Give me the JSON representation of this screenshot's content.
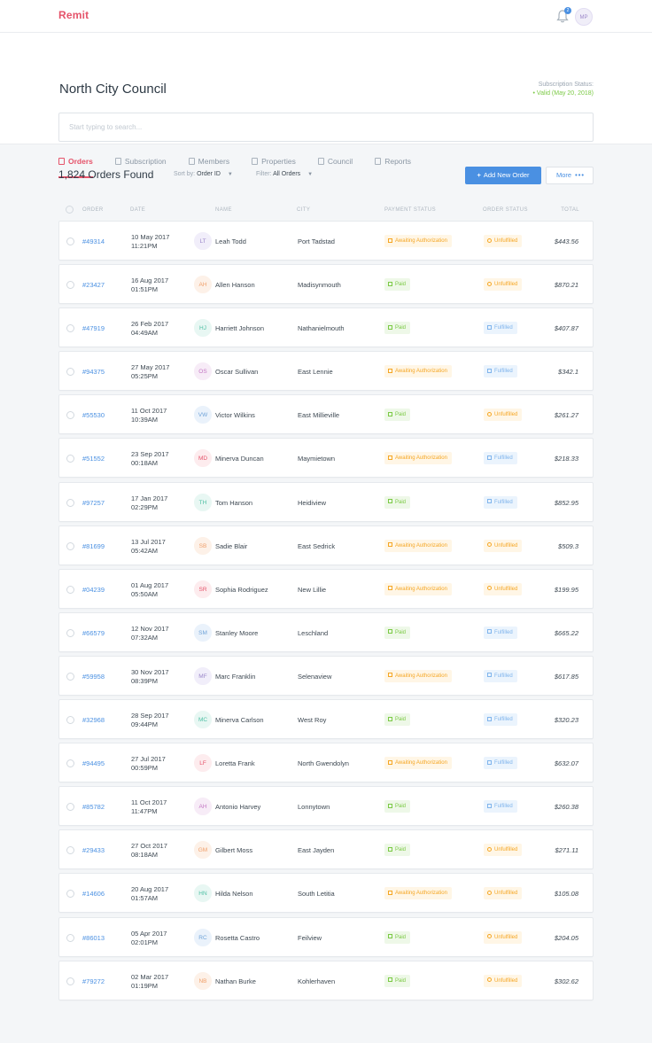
{
  "app": {
    "logo": "Remit",
    "avatar_initials": "MP",
    "notification_count": "2"
  },
  "header": {
    "title": "North City Council",
    "subscription_label": "Subscription Status:",
    "subscription_value": "• Valid (May 20, 2018)"
  },
  "search": {
    "placeholder": "Start typing to search..."
  },
  "tabs": [
    {
      "label": "Orders",
      "icon": "orders-icon"
    },
    {
      "label": "Subscription",
      "icon": "subscription-icon"
    },
    {
      "label": "Members",
      "icon": "members-icon"
    },
    {
      "label": "Properties",
      "icon": "properties-icon"
    },
    {
      "label": "Council",
      "icon": "council-icon"
    },
    {
      "label": "Reports",
      "icon": "reports-icon"
    }
  ],
  "toolbar": {
    "count": "1,824 Orders Found",
    "sort_label": "Sort by:",
    "sort_value": "Order ID",
    "filter_label": "Filter:",
    "filter_value": "All Orders",
    "add_button": "Add New Order",
    "more_button": "More"
  },
  "columns": [
    "ORDER",
    "DATE",
    "NAME",
    "CITY",
    "PAYMENT STATUS",
    "ORDER STATUS",
    "TOTAL"
  ],
  "orders": [
    {
      "id": "#49314",
      "date": "10 May 2017",
      "time": "11:21PM",
      "initials": "LT",
      "name": "Leah Todd",
      "city": "Port Tadstad",
      "payment": "Awaiting Authorization",
      "status": "Unfulfilled",
      "total": "$443.56",
      "av_bg": "#f1eefa",
      "av_fg": "#9b87c9"
    },
    {
      "id": "#23427",
      "date": "16 Aug 2017",
      "time": "01:51PM",
      "initials": "AH",
      "name": "Allen Hanson",
      "city": "Madisynmouth",
      "payment": "Paid",
      "status": "Unfulfilled",
      "total": "$870.21",
      "av_bg": "#fdf1e8",
      "av_fg": "#f0a06b"
    },
    {
      "id": "#47919",
      "date": "26 Feb 2017",
      "time": "04:49AM",
      "initials": "HJ",
      "name": "Harriett Johnson",
      "city": "Nathanielmouth",
      "payment": "Paid",
      "status": "Fulfilled",
      "total": "$407.87",
      "av_bg": "#e8f7f3",
      "av_fg": "#4dbfa3"
    },
    {
      "id": "#94375",
      "date": "27 May 2017",
      "time": "05:25PM",
      "initials": "OS",
      "name": "Oscar Sullivan",
      "city": "East Lennie",
      "payment": "Awaiting Authorization",
      "status": "Fulfilled",
      "total": "$342.1",
      "av_bg": "#f7ecf7",
      "av_fg": "#c477c4"
    },
    {
      "id": "#55530",
      "date": "11 Oct 2017",
      "time": "10:39AM",
      "initials": "VW",
      "name": "Victor Wilkins",
      "city": "East Millieville",
      "payment": "Paid",
      "status": "Unfulfilled",
      "total": "$261.27",
      "av_bg": "#eaf2fb",
      "av_fg": "#6fa3d8"
    },
    {
      "id": "#51552",
      "date": "23 Sep 2017",
      "time": "00:18AM",
      "initials": "MD",
      "name": "Minerva Duncan",
      "city": "Maymietown",
      "payment": "Awaiting Authorization",
      "status": "Fulfilled",
      "total": "$218.33",
      "av_bg": "#fdecee",
      "av_fg": "#e5536a"
    },
    {
      "id": "#97257",
      "date": "17 Jan 2017",
      "time": "02:29PM",
      "initials": "TH",
      "name": "Tom Hanson",
      "city": "Heidiview",
      "payment": "Paid",
      "status": "Fulfilled",
      "total": "$852.95",
      "av_bg": "#e8f7f3",
      "av_fg": "#4dbfa3"
    },
    {
      "id": "#81699",
      "date": "13 Jul 2017",
      "time": "05:42AM",
      "initials": "SB",
      "name": "Sadie Blair",
      "city": "East Sedrick",
      "payment": "Awaiting Authorization",
      "status": "Unfulfilled",
      "total": "$509.3",
      "av_bg": "#fdf1e8",
      "av_fg": "#f0a06b"
    },
    {
      "id": "#04239",
      "date": "01 Aug 2017",
      "time": "05:50AM",
      "initials": "SR",
      "name": "Sophia Rodriguez",
      "city": "New Lillie",
      "payment": "Awaiting Authorization",
      "status": "Unfulfilled",
      "total": "$199.95",
      "av_bg": "#fdecee",
      "av_fg": "#e5536a"
    },
    {
      "id": "#66579",
      "date": "12 Nov 2017",
      "time": "07:32AM",
      "initials": "SM",
      "name": "Stanley Moore",
      "city": "Leschland",
      "payment": "Paid",
      "status": "Fulfilled",
      "total": "$665.22",
      "av_bg": "#eaf2fb",
      "av_fg": "#6fa3d8"
    },
    {
      "id": "#59958",
      "date": "30 Nov 2017",
      "time": "08:39PM",
      "initials": "MF",
      "name": "Marc Franklin",
      "city": "Selenaview",
      "payment": "Awaiting Authorization",
      "status": "Fulfilled",
      "total": "$617.85",
      "av_bg": "#f1eefa",
      "av_fg": "#9b87c9"
    },
    {
      "id": "#32968",
      "date": "28 Sep 2017",
      "time": "09:44PM",
      "initials": "MC",
      "name": "Minerva Carlson",
      "city": "West Roy",
      "payment": "Paid",
      "status": "Fulfilled",
      "total": "$320.23",
      "av_bg": "#e8f7f3",
      "av_fg": "#4dbfa3"
    },
    {
      "id": "#94495",
      "date": "27 Jul 2017",
      "time": "00:59PM",
      "initials": "LF",
      "name": "Loretta Frank",
      "city": "North Gwendolyn",
      "payment": "Awaiting Authorization",
      "status": "Fulfilled",
      "total": "$632.07",
      "av_bg": "#fdecee",
      "av_fg": "#e5536a"
    },
    {
      "id": "#85782",
      "date": "11 Oct 2017",
      "time": "11:47PM",
      "initials": "AH",
      "name": "Antonio Harvey",
      "city": "Lonnytown",
      "payment": "Paid",
      "status": "Fulfilled",
      "total": "$260.38",
      "av_bg": "#f7ecf7",
      "av_fg": "#c477c4"
    },
    {
      "id": "#29433",
      "date": "27 Oct 2017",
      "time": "08:18AM",
      "initials": "GM",
      "name": "Gilbert Moss",
      "city": "East Jayden",
      "payment": "Paid",
      "status": "Unfulfilled",
      "total": "$271.11",
      "av_bg": "#fdf1e8",
      "av_fg": "#f0a06b"
    },
    {
      "id": "#14606",
      "date": "20 Aug 2017",
      "time": "01:57AM",
      "initials": "HN",
      "name": "Hilda Nelson",
      "city": "South Letitia",
      "payment": "Awaiting Authorization",
      "status": "Unfulfilled",
      "total": "$105.08",
      "av_bg": "#e8f7f3",
      "av_fg": "#4dbfa3"
    },
    {
      "id": "#86013",
      "date": "05 Apr 2017",
      "time": "02:01PM",
      "initials": "RC",
      "name": "Rosetta Castro",
      "city": "Feilview",
      "payment": "Paid",
      "status": "Unfulfilled",
      "total": "$204.05",
      "av_bg": "#eaf2fb",
      "av_fg": "#6fa3d8"
    },
    {
      "id": "#79272",
      "date": "02 Mar 2017",
      "time": "01:19PM",
      "initials": "NB",
      "name": "Nathan Burke",
      "city": "Kohlerhaven",
      "payment": "Paid",
      "status": "Unfulfilled",
      "total": "$302.62",
      "av_bg": "#fdf1e8",
      "av_fg": "#f0a06b"
    }
  ]
}
